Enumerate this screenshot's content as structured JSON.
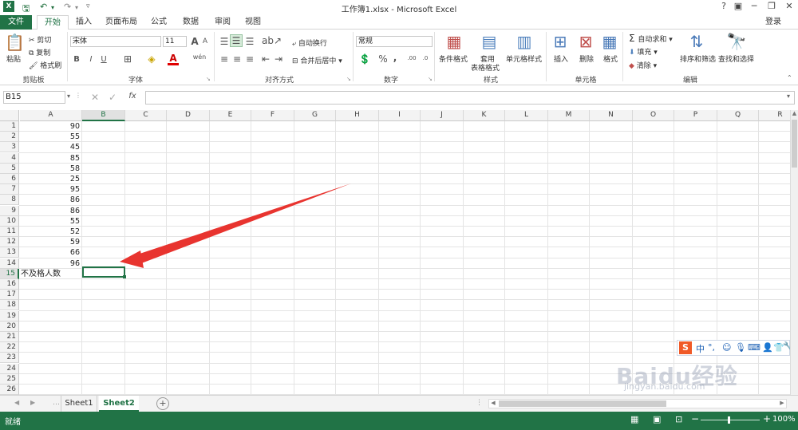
{
  "window": {
    "title": "工作簿1.xlsx - Microsoft Excel",
    "help": "?",
    "sign_in": "登录"
  },
  "tabs": [
    {
      "label": "文件"
    },
    {
      "label": "开始"
    },
    {
      "label": "插入"
    },
    {
      "label": "页面布局"
    },
    {
      "label": "公式"
    },
    {
      "label": "数据"
    },
    {
      "label": "审阅"
    },
    {
      "label": "视图"
    }
  ],
  "ribbon": {
    "clipboard": {
      "paste": "粘贴",
      "cut": "剪切",
      "copy": "复制",
      "format_painter": "格式刷",
      "group": "剪贴板"
    },
    "font": {
      "name": "宋体",
      "size": "11",
      "bold": "B",
      "italic": "I",
      "underline": "U",
      "grow": "A",
      "shrink": "A",
      "color": "A",
      "pinyin": "wén",
      "group": "字体"
    },
    "alignment": {
      "wrap": "自动换行",
      "merge": "合并后居中",
      "group": "对齐方式"
    },
    "number": {
      "format": "常规",
      "percent": "%",
      "comma": ",",
      "inc_dec": ".00",
      "dec_dec": ".0",
      "group": "数字"
    },
    "styles": {
      "conditional": "条件格式",
      "table_l1": "套用",
      "table_l2": "表格格式",
      "cell_styles": "单元格样式",
      "group": "样式"
    },
    "cells": {
      "insert": "插入",
      "delete": "删除",
      "format": "格式",
      "group": "单元格"
    },
    "editing": {
      "autosum": "自动求和",
      "fill": "填充",
      "clear": "清除",
      "sort": "排序和筛选",
      "find": "查找和选择",
      "group": "编辑"
    }
  },
  "formula_bar": {
    "name_box": "B15",
    "cancel": "✕",
    "enter": "✓",
    "fx": "fx",
    "value": ""
  },
  "sheet": {
    "columns": [
      "A",
      "B",
      "C",
      "D",
      "E",
      "F",
      "G",
      "H",
      "I",
      "J",
      "K",
      "L",
      "M",
      "N",
      "O",
      "P",
      "Q",
      "R"
    ],
    "rows": [
      "1",
      "2",
      "3",
      "4",
      "5",
      "6",
      "7",
      "8",
      "9",
      "10",
      "11",
      "12",
      "13",
      "14",
      "15",
      "16",
      "17",
      "18",
      "19",
      "20",
      "21",
      "22",
      "23",
      "24",
      "25",
      "26"
    ],
    "colA_values": [
      "90",
      "55",
      "45",
      "85",
      "58",
      "25",
      "95",
      "86",
      "86",
      "55",
      "52",
      "59",
      "66",
      "96"
    ],
    "a15_text": "不及格人数",
    "active_cell": "B15"
  },
  "sheet_tabs": [
    {
      "label": "Sheet1"
    },
    {
      "label": "Sheet2"
    }
  ],
  "status": {
    "ready": "就绪",
    "zoom": "100%",
    "minus": "−",
    "plus": "+"
  },
  "overlay": {
    "ime_lang": "中",
    "watermark": "Baidu经验",
    "watermark_url": "jingyan.baidu.com"
  },
  "colors": {
    "excel_green": "#217346",
    "arrow_red": "#e8342f"
  }
}
